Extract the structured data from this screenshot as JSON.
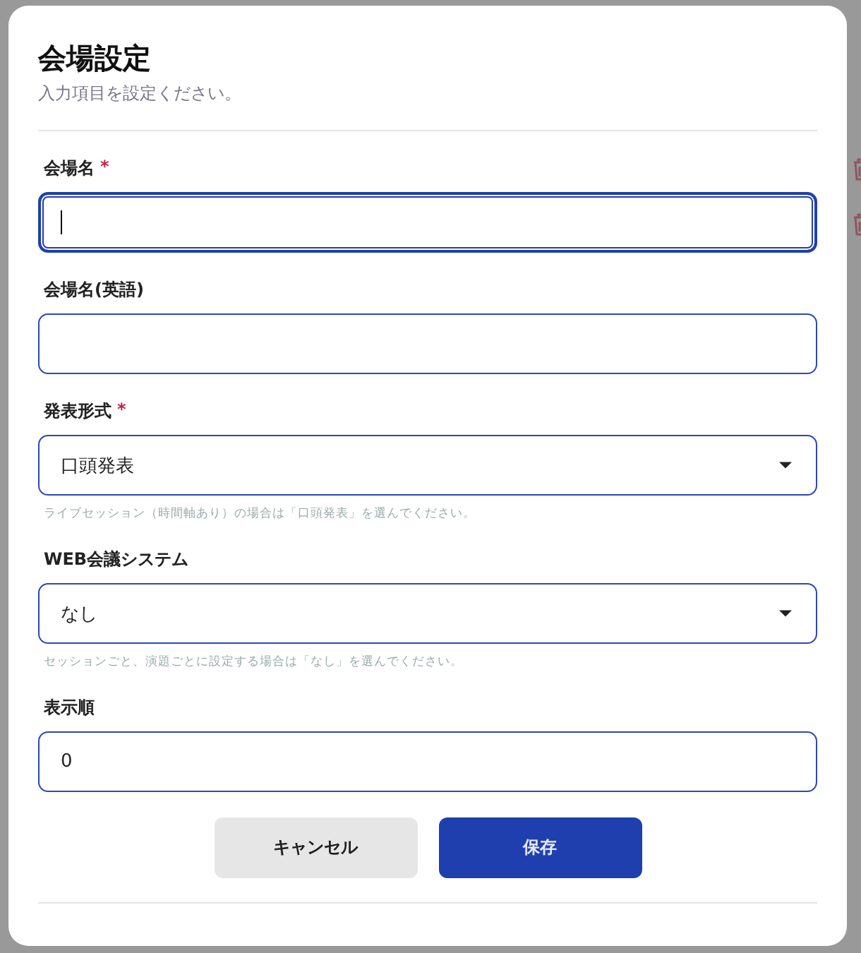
{
  "dialog": {
    "title": "会場設定",
    "subtitle": "入力項目を設定ください。"
  },
  "fields": [
    {
      "kind": "text",
      "label": "会場名",
      "mark": "*",
      "focused": true
    },
    {
      "kind": "text",
      "label": "会場名(英語)",
      "focused": false
    },
    {
      "kind": "select",
      "label": "発表形式",
      "mark": "*",
      "focused": false,
      "value": "口頭発表",
      "help": "ライブセッション（時間軸あり）の場合は「口頭発表」を選んでください。"
    },
    {
      "kind": "select",
      "label": "WEB会議システム",
      "focused": false,
      "value": "なし",
      "help": "セッションごと、演題ごとに設定する場合は「なし」を選んでください。"
    },
    {
      "kind": "text",
      "label": "表示順",
      "focused": false,
      "value": "0"
    }
  ],
  "buttons": [
    {
      "kind": "secondary",
      "label": "キャンセル"
    },
    {
      "kind": "primary",
      "label": "保存"
    }
  ]
}
